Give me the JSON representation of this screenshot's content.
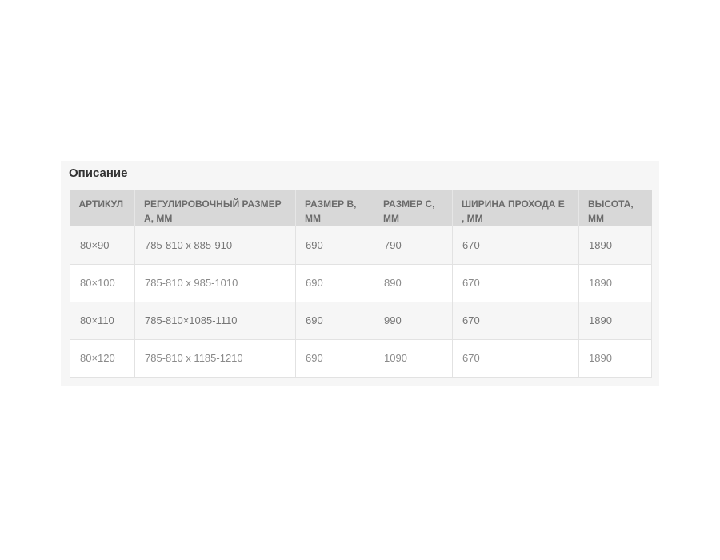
{
  "section": {
    "title": "Описание"
  },
  "table": {
    "headers": [
      "АРТИКУЛ",
      "РЕГУЛИРОВОЧНЫЙ РАЗМЕР А, ММ",
      "РАЗМЕР В, ММ",
      "РАЗМЕР С, ММ",
      "ШИРИНА ПРОХОДА Е , ММ",
      "ВЫСОТА, ММ"
    ],
    "rows": [
      [
        "80×90",
        "785-810 x 885-910",
        "690",
        "790",
        "670",
        "1890"
      ],
      [
        "80×100",
        "785-810 x 985-1010",
        "690",
        "890",
        "670",
        "1890"
      ],
      [
        "80×110",
        "785-810×1085-1110",
        "690",
        "990",
        "670",
        "1890"
      ],
      [
        "80×120",
        "785-810 x 1185-1210",
        "690",
        "1090",
        "670",
        "1890"
      ]
    ]
  }
}
